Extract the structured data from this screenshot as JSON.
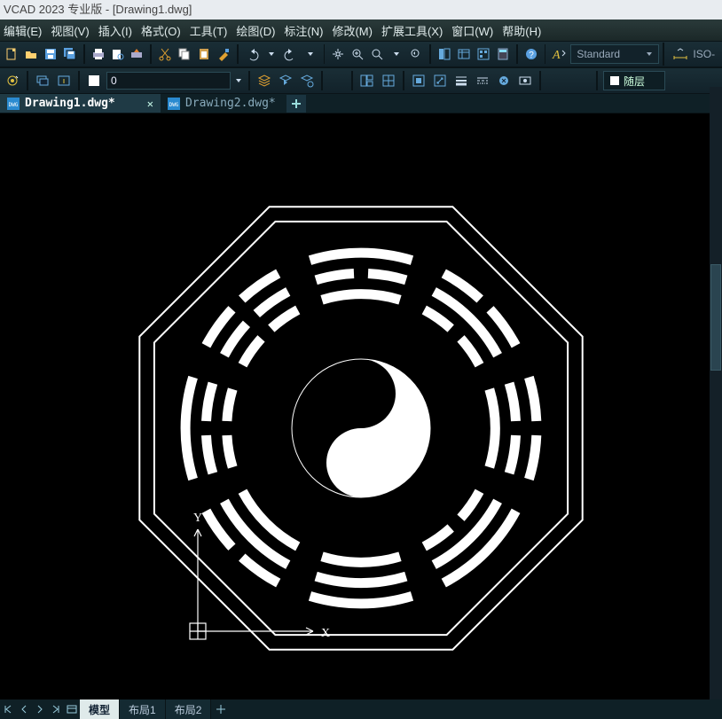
{
  "title": "VCAD 2023 专业版 - [Drawing1.dwg]",
  "menu": {
    "edit": "编辑(E)",
    "view": "视图(V)",
    "insert": "插入(I)",
    "format": "格式(O)",
    "tools": "工具(T)",
    "draw": "绘图(D)",
    "dim": "标注(N)",
    "modify": "修改(M)",
    "ext": "扩展工具(X)",
    "window": "窗口(W)",
    "help": "帮助(H)"
  },
  "toolbar1": {
    "text_style": "Standard",
    "dim_style": "ISO-"
  },
  "toolbar2": {
    "number": "0",
    "layer": "随层"
  },
  "tabs": [
    {
      "label": "Drawing1.dwg*",
      "active": true
    },
    {
      "label": "Drawing2.dwg*",
      "active": false
    }
  ],
  "bottom_tabs": {
    "model": "模型",
    "layout1": "布局1",
    "layout2": "布局2"
  },
  "drawing": {
    "x_axis": "X",
    "y_axis": "Y"
  },
  "icons": {
    "new": "new-icon",
    "open": "open-icon",
    "save": "save-icon",
    "cut": "cut-icon",
    "copy": "copy-icon",
    "paste": "paste-icon",
    "undo": "undo-icon",
    "redo": "redo-icon",
    "pan": "pan-icon",
    "zoom": "zoom-icon",
    "dwg": "dwg-icon"
  },
  "colors": {
    "accent": "#1f3a45",
    "canvas": "#000000",
    "line": "#ffffff"
  }
}
